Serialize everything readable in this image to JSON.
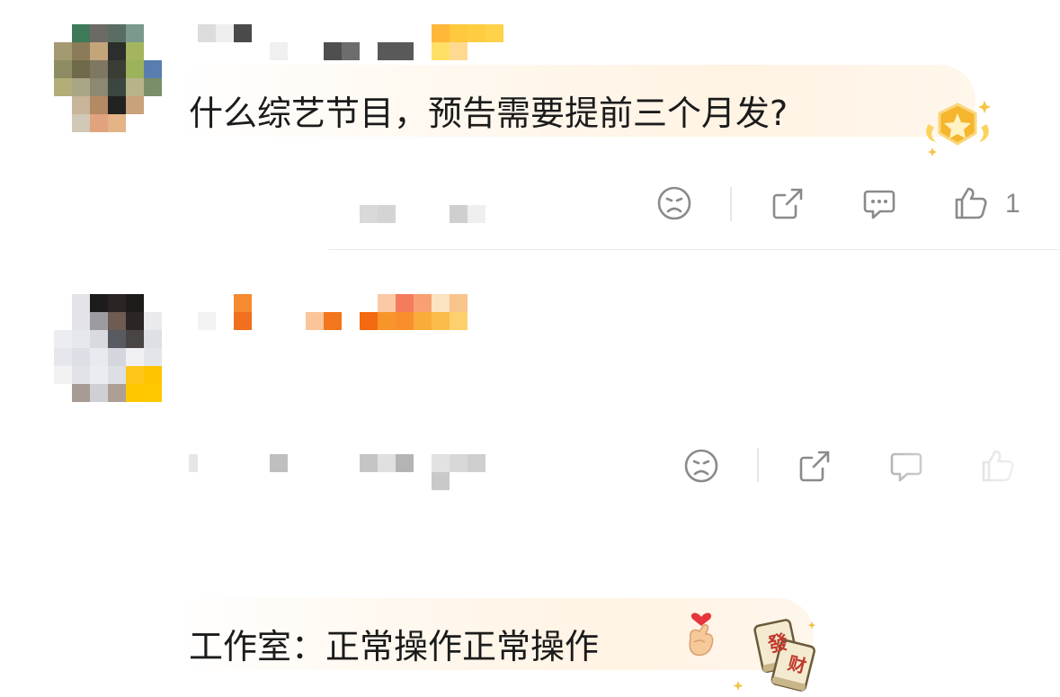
{
  "comments": [
    {
      "text": "什么综艺节目，预告需要提前三个月发?",
      "badge_icon": "star-shield-medal",
      "likes": "1",
      "colors": {
        "bubble": "#fff4e6",
        "badge": "#f5b52d"
      }
    },
    {
      "text": "工作室：正常操作正常操作",
      "emoji_icon": "heart-finger-emoji",
      "stamp_icon": "mahjong-fa-cai-tiles",
      "stamp_text": [
        "發",
        "财"
      ],
      "colors": {
        "bubble": "#fff4e6",
        "stamp": "#c0392b"
      }
    }
  ],
  "actions": {
    "dislike_icon": "frown-face-icon",
    "share_icon": "share-icon",
    "reply_icon": "comment-bubble-icon",
    "like_icon": "thumbs-up-icon"
  }
}
